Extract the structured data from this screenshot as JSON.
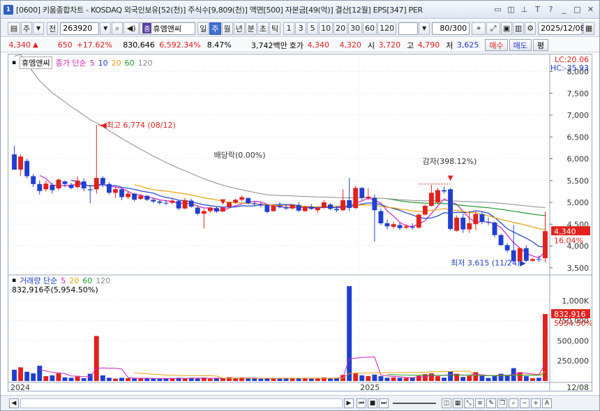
{
  "window": {
    "badge": "1",
    "title": "[0600] 키움종합차트 - KOSDAQ 외국인보유[52(천)] 주식수[9,809(천)] 액면[500] 자본금[49(억)] 결산[12월] EPS[347] PER",
    "controls": [
      "restore-icon",
      "tile-icon",
      "pin-icon",
      "font-icon",
      "help-icon",
      "minimize-icon",
      "maximize-icon",
      "close-icon"
    ]
  },
  "toolbar": {
    "period_type": "주",
    "prev_label": "전",
    "stock_code": "263920",
    "stock_badge": "종",
    "stock_name": "휴엠앤씨",
    "period_buttons": [
      "일",
      "주",
      "월",
      "년",
      "분",
      "초",
      "틱"
    ],
    "selected_period": "주",
    "interval_buttons": [
      "1",
      "3",
      "5",
      "10",
      "20",
      "30",
      "60",
      "120"
    ],
    "count": "80",
    "count_max": "/300",
    "date": "2025/12/08"
  },
  "quote": {
    "price": "4,340",
    "change": "650",
    "change_pct": "+17.62%",
    "volume": "830,646",
    "volume_pct": "6,592.34%",
    "turnover": "8.47%",
    "amount": "3,742백만",
    "bid_label": "호가",
    "bid1": "4,340",
    "bid2": "4,320",
    "open_label": "시",
    "open": "3,720",
    "high_label": "고",
    "high": "4,790",
    "low_label": "저",
    "low": "3,625",
    "buy_label": "매수",
    "sell_label": "매도",
    "avg_label": "평"
  },
  "price_panel": {
    "stock_tag": "휴엠앤씨",
    "legend_title": "종가 단순",
    "ma_periods": [
      "5",
      "10",
      "20",
      "60",
      "120"
    ],
    "ma_colors": [
      "#cf1fb9",
      "#1b3ec6",
      "#e5a20f",
      "#1f9a2c",
      "#8a8a8a"
    ],
    "lc": "LC:20.06",
    "hc": "HC:-35.93",
    "current_price_label": "4,340",
    "current_pct_label": "16.04%",
    "y_ticks": [
      "8,000",
      "7,500",
      "7,000",
      "6,500",
      "6,000",
      "5,500",
      "5,000",
      "4,500",
      "4,000",
      "3,500"
    ],
    "annotations": {
      "high": "최고 6,774 (08/12)",
      "dividend": "배당락(0.00%)",
      "reduction": "감자(398.12%)",
      "low": "최저 3,615 (11/24)"
    }
  },
  "volume_panel": {
    "legend_title": "거래량 단순",
    "ma_periods": [
      "5",
      "20",
      "60",
      "120"
    ],
    "info": "832,916주(5,954.50%)",
    "current_label": "832,916",
    "current_pct_label": "5954.50%",
    "y_ticks": [
      "1,000K",
      "750,000",
      "500,000",
      "250,000"
    ]
  },
  "x_axis": {
    "labels": [
      "2024",
      "2025",
      "12/08"
    ]
  },
  "chart_data": {
    "type": "candlestick",
    "period": "weekly",
    "ylim": [
      3400,
      8200
    ],
    "candles": [
      {
        "o": 6100,
        "h": 6300,
        "l": 5750,
        "c": 5750
      },
      {
        "o": 5750,
        "h": 6100,
        "l": 5600,
        "c": 6050
      },
      {
        "o": 5950,
        "h": 6000,
        "l": 5550,
        "c": 5600
      },
      {
        "o": 5600,
        "h": 5650,
        "l": 5350,
        "c": 5420
      },
      {
        "o": 5420,
        "h": 5500,
        "l": 5180,
        "c": 5260
      },
      {
        "o": 5300,
        "h": 5500,
        "l": 5250,
        "c": 5430
      },
      {
        "o": 5400,
        "h": 5450,
        "l": 5200,
        "c": 5280
      },
      {
        "o": 5320,
        "h": 5550,
        "l": 5280,
        "c": 5520
      },
      {
        "o": 5480,
        "h": 5500,
        "l": 5350,
        "c": 5420
      },
      {
        "o": 5400,
        "h": 5450,
        "l": 5300,
        "c": 5330
      },
      {
        "o": 5350,
        "h": 5600,
        "l": 5320,
        "c": 5500
      },
      {
        "o": 5480,
        "h": 5550,
        "l": 5250,
        "c": 5320
      },
      {
        "o": 5300,
        "h": 5400,
        "l": 4980,
        "c": 5280
      },
      {
        "o": 5300,
        "h": 6774,
        "l": 5200,
        "c": 5560
      },
      {
        "o": 5560,
        "h": 5600,
        "l": 5350,
        "c": 5420
      },
      {
        "o": 5420,
        "h": 5460,
        "l": 5180,
        "c": 5220
      },
      {
        "o": 5220,
        "h": 5350,
        "l": 5100,
        "c": 5300
      },
      {
        "o": 5300,
        "h": 5320,
        "l": 5050,
        "c": 5120
      },
      {
        "o": 5120,
        "h": 5250,
        "l": 5080,
        "c": 5200
      },
      {
        "o": 5200,
        "h": 5220,
        "l": 5020,
        "c": 5060
      },
      {
        "o": 5080,
        "h": 5200,
        "l": 5050,
        "c": 5150
      },
      {
        "o": 5150,
        "h": 5170,
        "l": 5030,
        "c": 5060
      },
      {
        "o": 5060,
        "h": 5100,
        "l": 4980,
        "c": 5020
      },
      {
        "o": 5020,
        "h": 5060,
        "l": 4950,
        "c": 4990
      },
      {
        "o": 4990,
        "h": 5050,
        "l": 4940,
        "c": 4980
      },
      {
        "o": 4990,
        "h": 5080,
        "l": 4960,
        "c": 5040
      },
      {
        "o": 5030,
        "h": 5050,
        "l": 4820,
        "c": 4860
      },
      {
        "o": 4860,
        "h": 5100,
        "l": 4840,
        "c": 5050
      },
      {
        "o": 5040,
        "h": 5080,
        "l": 4880,
        "c": 4900
      },
      {
        "o": 4880,
        "h": 4920,
        "l": 4700,
        "c": 4740
      },
      {
        "o": 4740,
        "h": 4840,
        "l": 4400,
        "c": 4800
      },
      {
        "o": 4800,
        "h": 4900,
        "l": 4760,
        "c": 4880
      },
      {
        "o": 4870,
        "h": 4900,
        "l": 4760,
        "c": 4790
      },
      {
        "o": 4790,
        "h": 4900,
        "l": 4780,
        "c": 4880
      },
      {
        "o": 4900,
        "h": 5020,
        "l": 4880,
        "c": 5000
      },
      {
        "o": 5000,
        "h": 5080,
        "l": 4960,
        "c": 5060
      },
      {
        "o": 5060,
        "h": 5160,
        "l": 5030,
        "c": 5120
      },
      {
        "o": 5100,
        "h": 5110,
        "l": 4950,
        "c": 4980
      },
      {
        "o": 4980,
        "h": 5020,
        "l": 4920,
        "c": 4960
      },
      {
        "o": 4960,
        "h": 5000,
        "l": 4880,
        "c": 4940
      },
      {
        "o": 4940,
        "h": 4960,
        "l": 4750,
        "c": 4780
      },
      {
        "o": 4800,
        "h": 4960,
        "l": 4780,
        "c": 4920
      },
      {
        "o": 4920,
        "h": 5000,
        "l": 4860,
        "c": 4890
      },
      {
        "o": 4890,
        "h": 4950,
        "l": 4820,
        "c": 4860
      },
      {
        "o": 4860,
        "h": 4960,
        "l": 4840,
        "c": 4940
      },
      {
        "o": 4940,
        "h": 5000,
        "l": 4780,
        "c": 4810
      },
      {
        "o": 4800,
        "h": 4920,
        "l": 4780,
        "c": 4900
      },
      {
        "o": 4900,
        "h": 4960,
        "l": 4830,
        "c": 4850
      },
      {
        "o": 4820,
        "h": 4900,
        "l": 4760,
        "c": 4870
      },
      {
        "o": 4880,
        "h": 5050,
        "l": 4850,
        "c": 5000
      },
      {
        "o": 4950,
        "h": 4980,
        "l": 4820,
        "c": 4850
      },
      {
        "o": 4850,
        "h": 4920,
        "l": 4780,
        "c": 4820
      },
      {
        "o": 4820,
        "h": 5300,
        "l": 4800,
        "c": 5050
      },
      {
        "o": 5050,
        "h": 5560,
        "l": 4800,
        "c": 4870
      },
      {
        "o": 4870,
        "h": 5380,
        "l": 4850,
        "c": 5330
      },
      {
        "o": 5330,
        "h": 5350,
        "l": 5050,
        "c": 5100
      },
      {
        "o": 5100,
        "h": 5320,
        "l": 5050,
        "c": 5130
      },
      {
        "o": 5100,
        "h": 5180,
        "l": 4100,
        "c": 4820
      },
      {
        "o": 4800,
        "h": 4860,
        "l": 4480,
        "c": 4520
      },
      {
        "o": 4520,
        "h": 4620,
        "l": 4380,
        "c": 4450
      },
      {
        "o": 4440,
        "h": 4560,
        "l": 4400,
        "c": 4500
      },
      {
        "o": 4480,
        "h": 4540,
        "l": 4360,
        "c": 4410
      },
      {
        "o": 4420,
        "h": 4500,
        "l": 4380,
        "c": 4450
      },
      {
        "o": 4440,
        "h": 4520,
        "l": 4380,
        "c": 4420
      },
      {
        "o": 4420,
        "h": 4750,
        "l": 4400,
        "c": 4720
      },
      {
        "o": 4720,
        "h": 4950,
        "l": 4700,
        "c": 4920
      },
      {
        "o": 4920,
        "h": 5400,
        "l": 4900,
        "c": 5220
      },
      {
        "o": 5000,
        "h": 5330,
        "l": 4950,
        "c": 5280
      },
      {
        "o": 5280,
        "h": 5360,
        "l": 5200,
        "c": 5250
      },
      {
        "o": 5300,
        "h": 5330,
        "l": 4350,
        "c": 4390
      },
      {
        "o": 4350,
        "h": 4700,
        "l": 4330,
        "c": 4650
      },
      {
        "o": 4650,
        "h": 4740,
        "l": 4300,
        "c": 4380
      },
      {
        "o": 4380,
        "h": 4800,
        "l": 4300,
        "c": 4520
      },
      {
        "o": 4500,
        "h": 4800,
        "l": 4360,
        "c": 4730
      },
      {
        "o": 4730,
        "h": 4780,
        "l": 4500,
        "c": 4550
      },
      {
        "o": 4550,
        "h": 4650,
        "l": 4480,
        "c": 4540
      },
      {
        "o": 4540,
        "h": 4560,
        "l": 4200,
        "c": 4250
      },
      {
        "o": 4250,
        "h": 4280,
        "l": 4000,
        "c": 4020
      },
      {
        "o": 4020,
        "h": 4060,
        "l": 3850,
        "c": 3900
      },
      {
        "o": 3900,
        "h": 4480,
        "l": 3615,
        "c": 3650
      },
      {
        "o": 3650,
        "h": 3960,
        "l": 3620,
        "c": 3950
      },
      {
        "o": 3950,
        "h": 4020,
        "l": 3630,
        "c": 3660
      },
      {
        "o": 3660,
        "h": 3730,
        "l": 3640,
        "c": 3700
      },
      {
        "o": 3700,
        "h": 3780,
        "l": 3640,
        "c": 3690
      },
      {
        "o": 3720,
        "h": 4790,
        "l": 3625,
        "c": 4340
      }
    ],
    "volumes": [
      140000,
      170000,
      115000,
      95000,
      190000,
      60000,
      70000,
      95000,
      45000,
      40000,
      55000,
      35000,
      90000,
      560000,
      70000,
      40000,
      30000,
      40000,
      35000,
      32000,
      38000,
      30000,
      30000,
      28000,
      30000,
      36000,
      40000,
      30000,
      40000,
      30000,
      42000,
      28000,
      32000,
      30000,
      48000,
      38000,
      45000,
      30000,
      30000,
      28000,
      32000,
      38000,
      30000,
      32000,
      40000,
      32000,
      35000,
      28000,
      30000,
      45000,
      30000,
      40000,
      75000,
      1180000,
      100000,
      70000,
      62000,
      80000,
      60000,
      40000,
      45000,
      40000,
      38000,
      45000,
      65000,
      85000,
      95000,
      60000,
      42000,
      120000,
      90000,
      50000,
      65000,
      110000,
      70000,
      38000,
      60000,
      90000,
      75000,
      160000,
      110000,
      60000,
      35000,
      40000,
      832916
    ]
  }
}
